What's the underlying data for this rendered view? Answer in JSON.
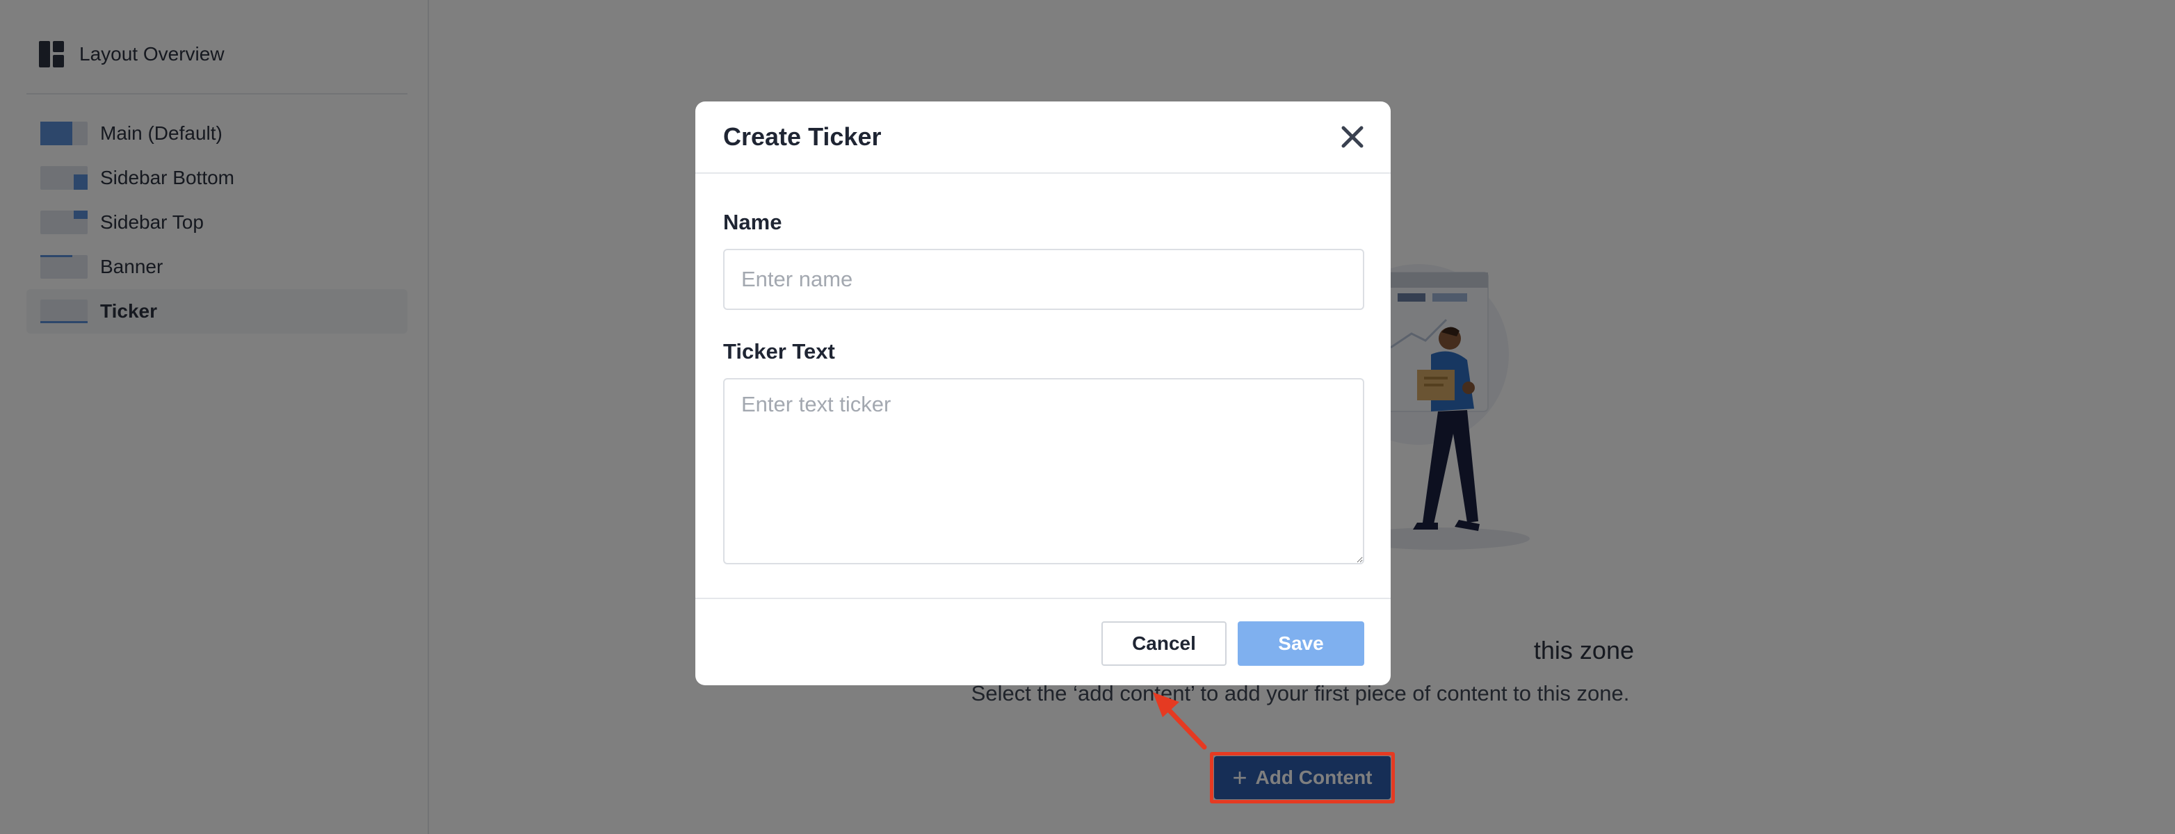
{
  "sidebar": {
    "header": {
      "title": "Layout Overview",
      "icon": "layout-grid-icon"
    },
    "items": [
      {
        "label": "Main (Default)",
        "icon": "layout-main-thumbnail-icon",
        "active": false
      },
      {
        "label": "Sidebar Bottom",
        "icon": "layout-sidebar-bottom-thumbnail-icon",
        "active": false
      },
      {
        "label": "Sidebar Top",
        "icon": "layout-sidebar-top-thumbnail-icon",
        "active": false
      },
      {
        "label": "Banner",
        "icon": "layout-banner-thumbnail-icon",
        "active": false
      },
      {
        "label": "Ticker",
        "icon": "layout-ticker-thumbnail-icon",
        "active": true
      }
    ]
  },
  "main": {
    "empty_state": {
      "title_visible_fragment": "this zone",
      "subtitle": "Select the ‘add content’ to add your first piece of content to this zone.",
      "illustration": "person-carrying-box-illustration"
    },
    "add_button": {
      "label": "Add Content",
      "icon": "plus-icon"
    }
  },
  "modal": {
    "title": "Create Ticker",
    "close_icon": "close-icon",
    "fields": {
      "name": {
        "label": "Name",
        "placeholder": "Enter name",
        "value": ""
      },
      "ticker_text": {
        "label": "Ticker Text",
        "placeholder": "Enter text ticker",
        "value": ""
      }
    },
    "buttons": {
      "cancel": "Cancel",
      "save": "Save"
    }
  },
  "colors": {
    "accent": "#2c5cad",
    "save_disabled": "#7fb0ef",
    "highlight": "#e53a22",
    "overlay": "rgba(0,0,0,0.5)"
  }
}
